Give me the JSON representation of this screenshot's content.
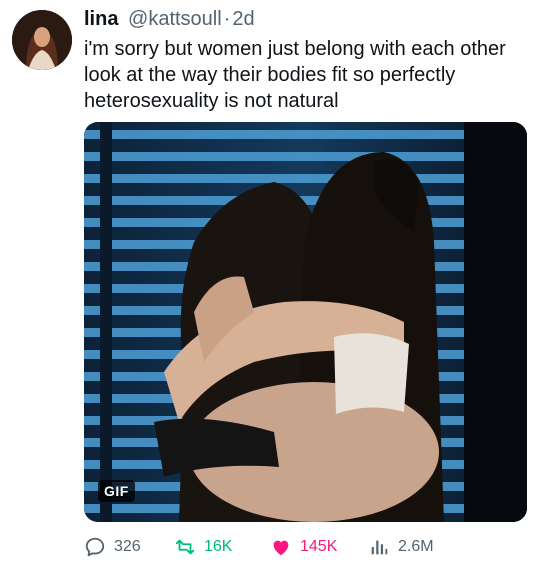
{
  "user": {
    "name": "lina",
    "handle": "@kattsoull",
    "separator": "·",
    "time": "2d"
  },
  "tweet": {
    "lines": [
      "i'm sorry but women just belong with each other",
      "look at the way their bodies fit so perfectly",
      "heterosexuality is not natural"
    ]
  },
  "media": {
    "badge": "GIF"
  },
  "actions": {
    "replies": "326",
    "retweets": "16K",
    "likes": "145K",
    "views": "2.6M"
  },
  "colors": {
    "retweet": "#00ba7c",
    "like": "#f91880",
    "muted": "#536471"
  },
  "icons": {
    "reply": "reply-icon",
    "retweet": "retweet-icon",
    "like": "heart-icon",
    "views": "views-icon"
  }
}
